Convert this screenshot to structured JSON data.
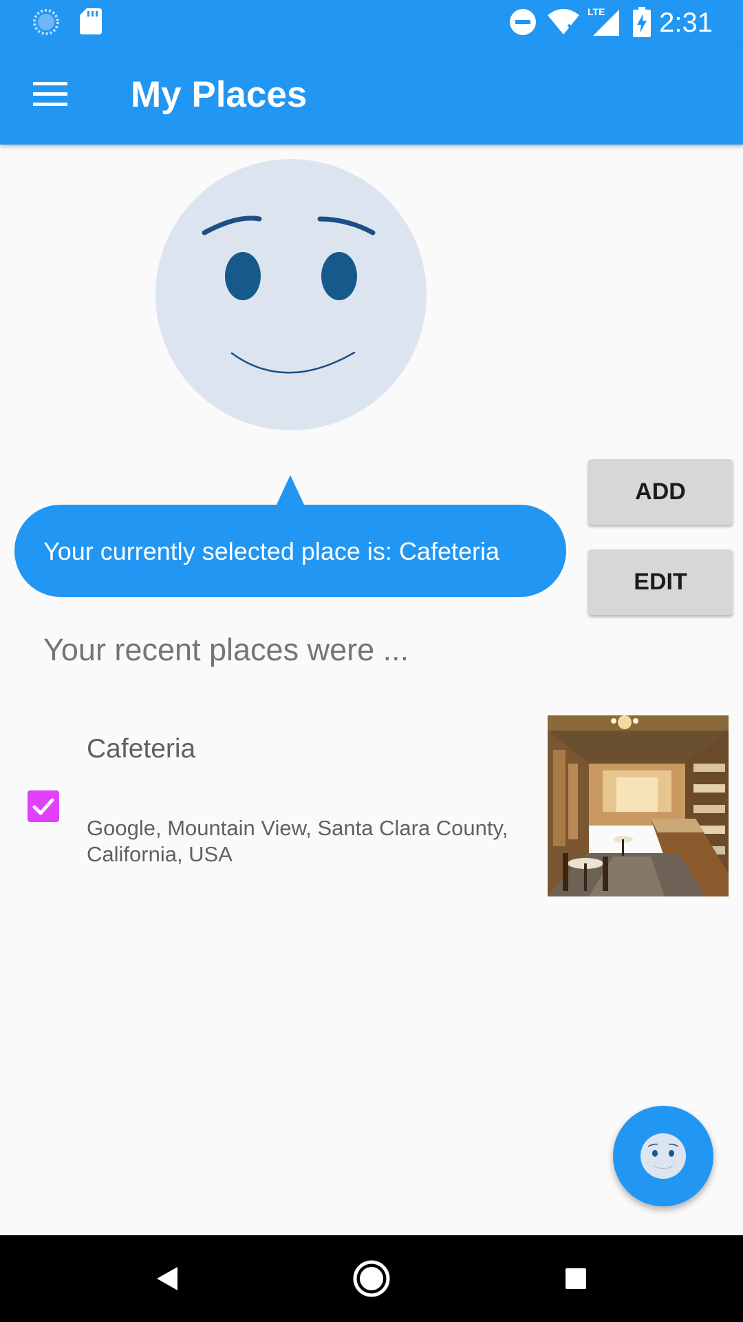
{
  "status_bar": {
    "time": "2:31",
    "icons": [
      "sync-icon",
      "sd-card-icon",
      "do-not-disturb-icon",
      "wifi-icon",
      "lte-signal-icon",
      "battery-charging-icon"
    ],
    "network_label": "LTE"
  },
  "app_bar": {
    "title": "My Places",
    "menu_icon": "hamburger-menu-icon"
  },
  "avatar": {
    "icon": "smiley-face-avatar",
    "face_color": "#dce5ef",
    "eye_color": "#155a8a"
  },
  "speech_bubble": {
    "text": "Your currently selected place is: Cafeteria"
  },
  "buttons": {
    "add_label": "ADD",
    "edit_label": "EDIT"
  },
  "recent": {
    "heading": "Your recent places were ...",
    "items": [
      {
        "name": "Cafeteria",
        "address": "Google, Mountain View, Santa Clara County, California, USA",
        "checked": true,
        "photo": "cafeteria-interior-photo"
      }
    ]
  },
  "fab": {
    "icon": "smiley-face-icon"
  },
  "nav_bar": {
    "back_icon": "back-triangle-icon",
    "home_icon": "home-circle-icon",
    "recents_icon": "recents-square-icon"
  },
  "colors": {
    "primary": "#2196f3",
    "accent": "#e040fb",
    "button_bg": "#d6d7d7",
    "background": "#fafafa"
  }
}
